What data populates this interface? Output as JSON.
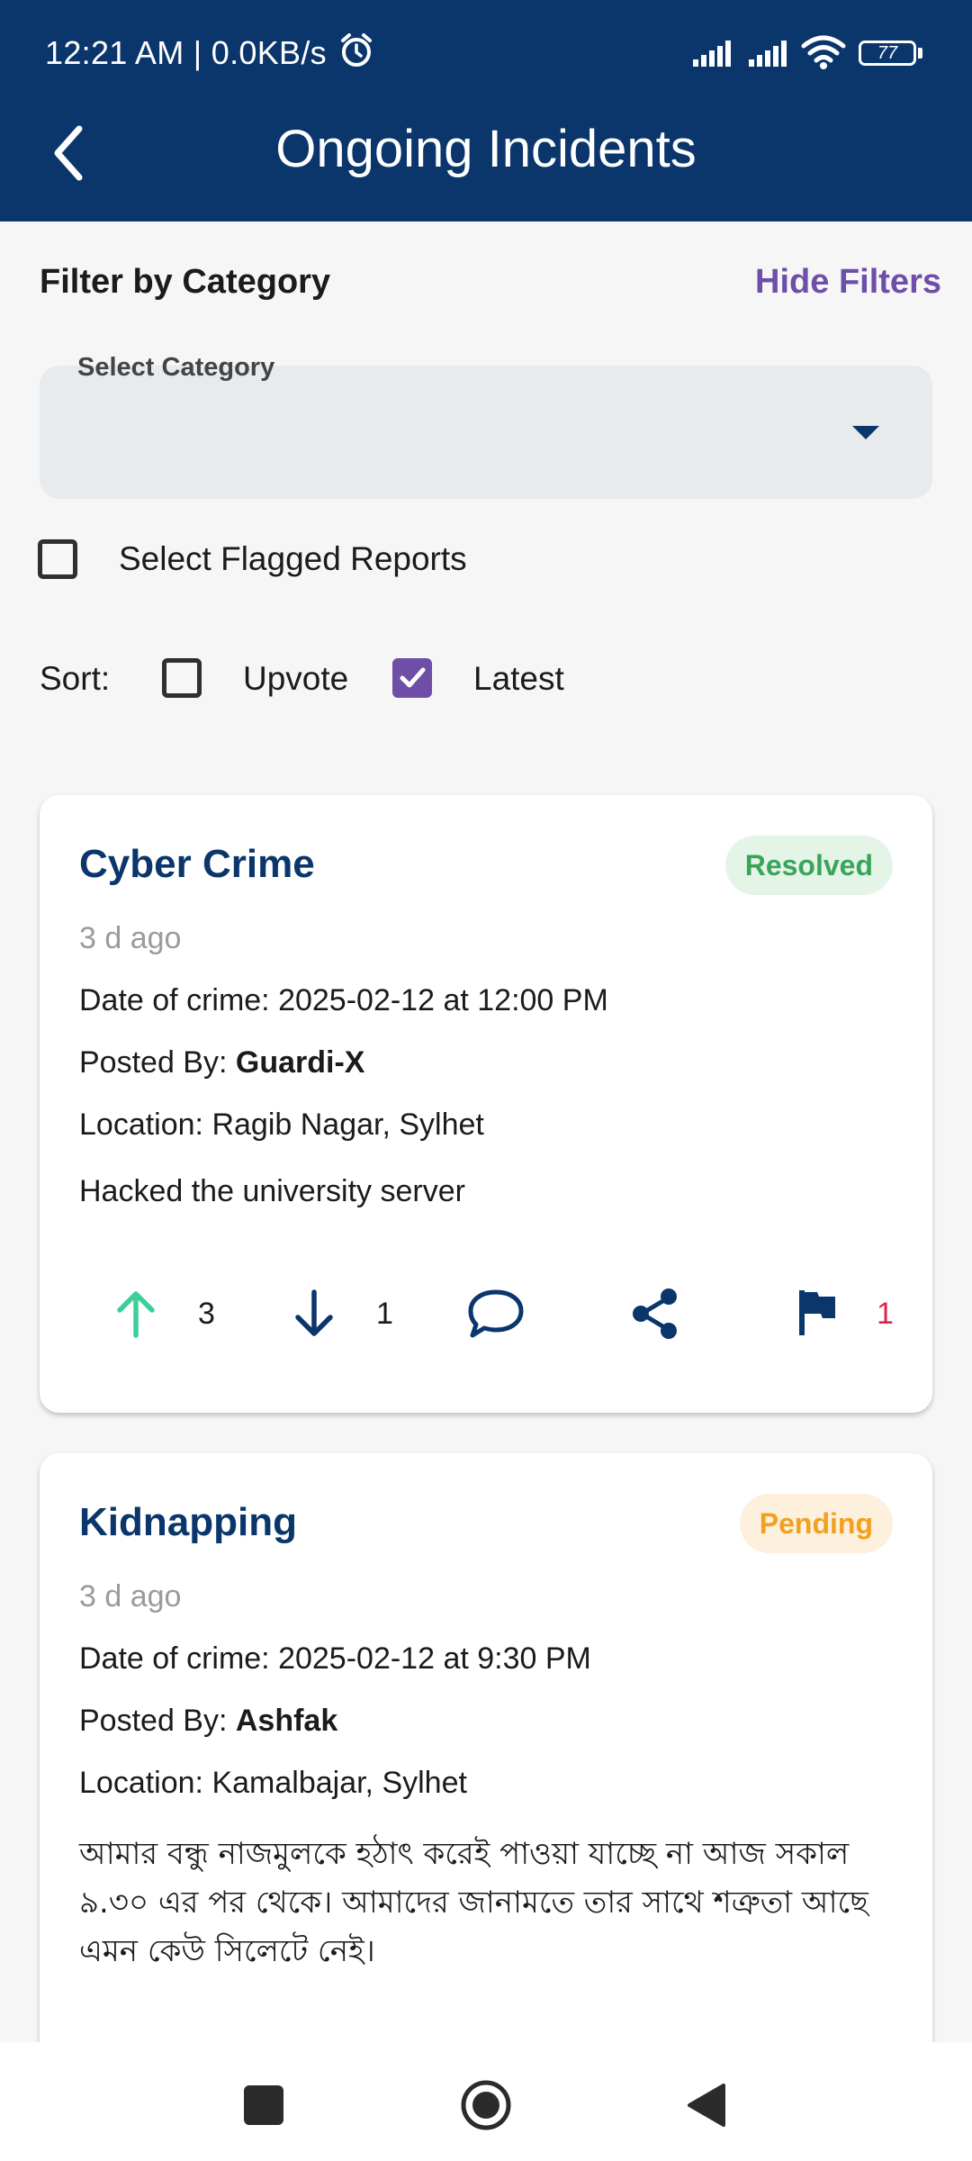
{
  "status_bar": {
    "time": "12:21 AM | 0.0KB/s",
    "battery": "77"
  },
  "header": {
    "title": "Ongoing Incidents",
    "back_icon": "chevron-left-icon"
  },
  "filters": {
    "title": "Filter by Category",
    "toggle_label": "Hide Filters",
    "category_label": "Select Category",
    "category_value": "",
    "flagged_label": "Select Flagged Reports",
    "flagged_checked": false,
    "sort_label": "Sort:",
    "sort_upvote_label": "Upvote",
    "sort_upvote_checked": false,
    "sort_latest_label": "Latest",
    "sort_latest_checked": true
  },
  "incidents": [
    {
      "category": "Cyber Crime",
      "status": "Resolved",
      "time_ago": "3 d ago",
      "date_prefix": "Date of crime: ",
      "date_value": "2025-02-12 at 12:00 PM",
      "posted_prefix": "Posted By: ",
      "posted_by": "Guardi-X",
      "location_prefix": "Location: ",
      "location": "Ragib Nagar, Sylhet",
      "description": "Hacked the university server",
      "upvotes": "3",
      "downvotes": "1",
      "flags": "1"
    },
    {
      "category": "Kidnapping",
      "status": "Pending",
      "time_ago": "3 d ago",
      "date_prefix": "Date of crime: ",
      "date_value": "2025-02-12 at 9:30 PM",
      "posted_prefix": "Posted By: ",
      "posted_by": "Ashfak",
      "location_prefix": "Location: ",
      "location": "Kamalbajar, Sylhet",
      "description": "আমার বন্ধু নাজমুলকে হঠাৎ করেই পাওয়া যাচ্ছে না আজ সকাল ৯.৩০ এর পর থেকে। আমাদের জানামতে তার সাথে শত্রুতা আছে এমন কেউ সিলেটে নেই।"
    }
  ],
  "colors": {
    "primary": "#0a366b",
    "accent": "#6e4fa8",
    "resolved_text": "#3aa55a",
    "resolved_bg": "#e4f5e8",
    "pending_text": "#f2a020",
    "pending_bg": "#fdf0dc",
    "upvote": "#3ccf9a",
    "flag_count": "#d8284a"
  }
}
